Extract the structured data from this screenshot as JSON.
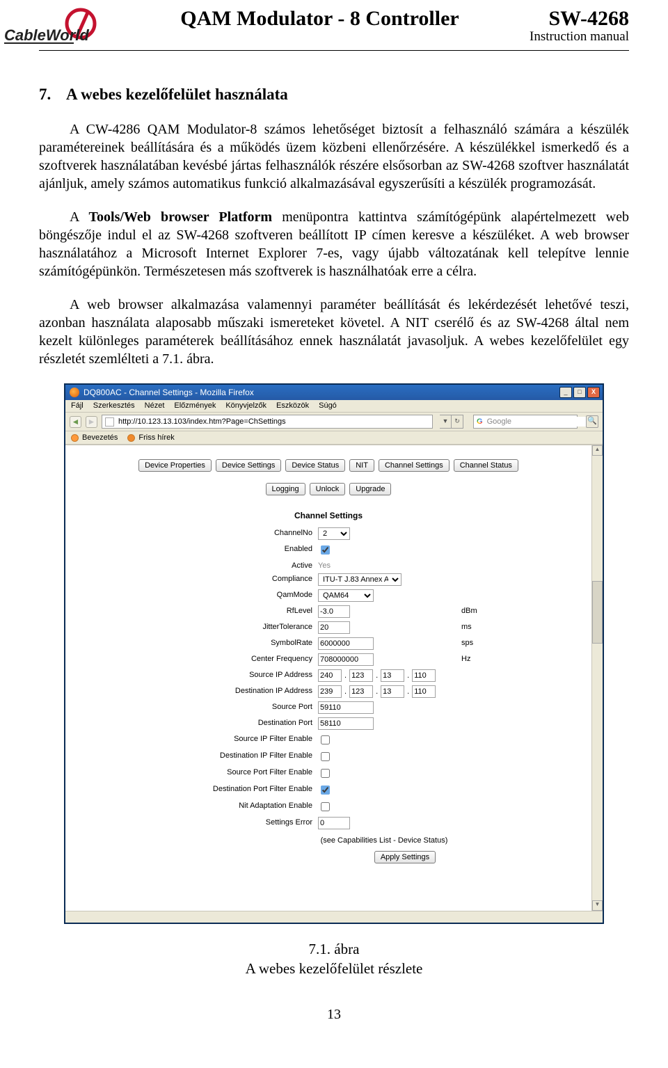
{
  "header": {
    "logo_text": "CableWorld",
    "center_title": "QAM Modulator - 8  Controller",
    "sw": "SW-4268",
    "sub": "Instruction manual"
  },
  "section": {
    "number": "7.",
    "title": "A webes kezelőfelület használata",
    "p1": "A CW-4286 QAM Modulator-8 számos lehetőséget biztosít a felhasználó számára a készülék paramétereinek beállítására és a működés üzem közbeni ellenőrzésére. A készülékkel ismerkedő és a szoftverek használatában kevésbé jártas felhasználók részére elsősorban az SW-4268 szoftver használatát ajánljuk, amely számos automatikus funkció alkalmazásával egyszerűsíti a készülék programozását.",
    "p2a": "A ",
    "p2b_bold": "Tools/Web browser Platform",
    "p2c": " menüpontra kattintva számítógépünk alapértelmezett web böngészője indul el az SW-4268 szoftveren beállított IP címen keresve a készüléket. A web browser használatához a Microsoft Internet Explorer 7-es, vagy újabb változatának kell telepítve lennie számítógépünkön. Természetesen más szoftverek is használhatóak erre a célra.",
    "p3": "A web browser alkalmazása valamennyi paraméter beállítását és lekérdezését lehetővé teszi, azonban használata alaposabb műszaki ismereteket követel. A NIT cserélő és az SW-4268 által nem kezelt különleges paraméterek beállításához ennek használatát javasoljuk. A webes kezelőfelület egy részletét szemlélteti a 7.1. ábra."
  },
  "firefox": {
    "title": "DQ800AC - Channel Settings - Mozilla Firefox",
    "menus": [
      "Fájl",
      "Szerkesztés",
      "Nézet",
      "Előzmények",
      "Könyvjelzők",
      "Eszközök",
      "Súgó"
    ],
    "address": "http://10.123.13.103/index.htm?Page=ChSettings",
    "search_placeholder": "Google",
    "bookmarks": [
      "Bevezetés",
      "Friss hírek"
    ]
  },
  "app": {
    "tabs_row1": [
      "Device Properties",
      "Device Settings",
      "Device Status",
      "NIT",
      "Channel Settings",
      "Channel Status"
    ],
    "tabs_row2": [
      "Logging",
      "Unlock",
      "Upgrade"
    ],
    "section_title": "Channel Settings",
    "fields": {
      "channelno": {
        "label": "ChannelNo",
        "value": "2"
      },
      "enabled": {
        "label": "Enabled",
        "checked": true
      },
      "active": {
        "label": "Active",
        "value": "Yes"
      },
      "compliance": {
        "label": "Compliance",
        "value": "ITU-T J.83 Annex A"
      },
      "qammode": {
        "label": "QamMode",
        "value": "QAM64"
      },
      "rflevel": {
        "label": "RfLevel",
        "value": "-3.0",
        "unit": "dBm"
      },
      "jitter": {
        "label": "JitterTolerance",
        "value": "20",
        "unit": "ms"
      },
      "symbolrate": {
        "label": "SymbolRate",
        "value": "6000000",
        "unit": "sps"
      },
      "centerfreq": {
        "label": "Center Frequency",
        "value": "708000000",
        "unit": "Hz"
      },
      "srcip": {
        "label": "Source IP Address",
        "octets": [
          "240",
          "123",
          "13",
          "110"
        ]
      },
      "dstip": {
        "label": "Destination IP Address",
        "octets": [
          "239",
          "123",
          "13",
          "110"
        ]
      },
      "srcport": {
        "label": "Source Port",
        "value": "59110"
      },
      "dstport": {
        "label": "Destination Port",
        "value": "58110"
      },
      "sipfe": {
        "label": "Source IP Filter Enable",
        "checked": false
      },
      "dipfe": {
        "label": "Destination IP Filter Enable",
        "checked": false
      },
      "spfe": {
        "label": "Source Port Filter Enable",
        "checked": false
      },
      "dpfe": {
        "label": "Destination Port Filter Enable",
        "checked": true
      },
      "nitae": {
        "label": "Nit Adaptation Enable",
        "checked": false
      },
      "serr": {
        "label": "Settings Error",
        "value": "0"
      }
    },
    "help_line": "(see Capabilities List - Device Status)",
    "apply_label": "Apply Settings"
  },
  "caption": {
    "line1": "7.1. ábra",
    "line2": "A webes kezelőfelület részlete"
  },
  "page_number": "13"
}
